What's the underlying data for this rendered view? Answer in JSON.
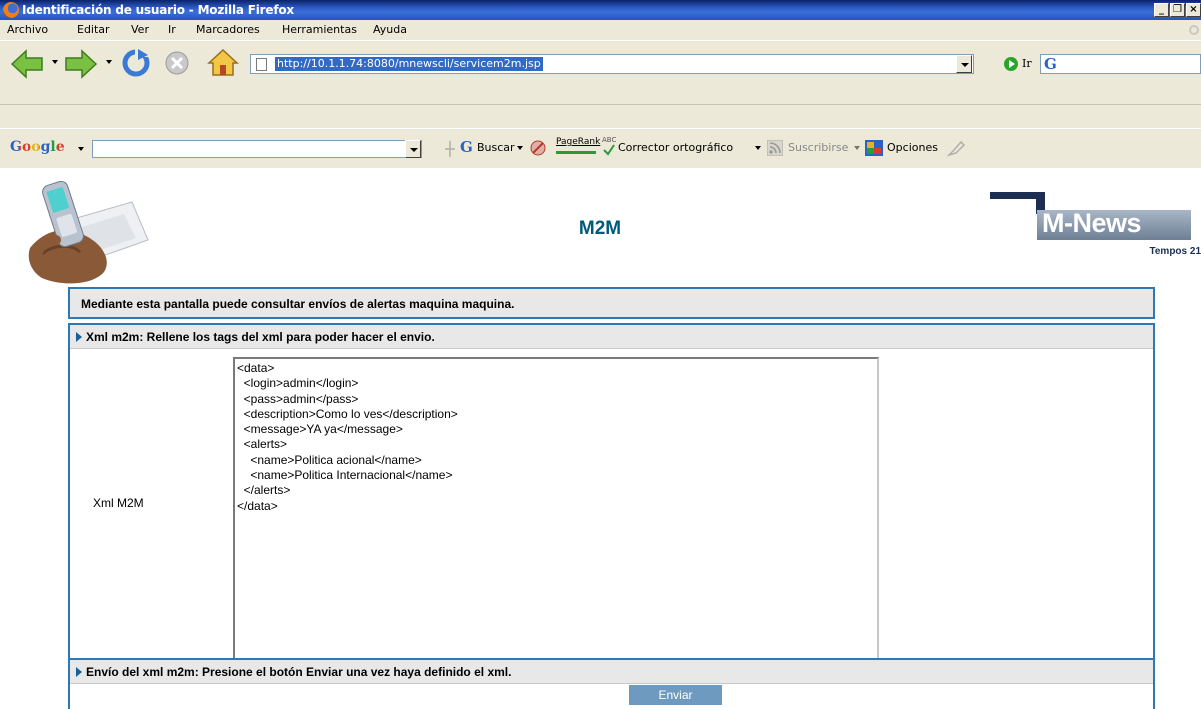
{
  "window": {
    "title": "Identificación de usuario - Mozilla Firefox",
    "controls": {
      "minimize": "_",
      "restore": "❐",
      "close": "×"
    }
  },
  "menu": [
    "Archivo",
    "Editar",
    "Ver",
    "Ir",
    "Marcadores",
    "Herramientas",
    "Ayuda"
  ],
  "navigation": {
    "url": "http://10.1.1.74:8080/mnewscli/servicem2m.jsp",
    "go_label": "Ir",
    "search_glyph": "G"
  },
  "google_toolbar": {
    "logo": "Google",
    "buscar": "Buscar",
    "pagerank": "PageRank",
    "abc": "ABC",
    "corrector": "Corrector ortográfico",
    "suscribirse": "Suscribirse",
    "opciones": "Opciones"
  },
  "page": {
    "heading": "M2M",
    "brand_logo": "M-News",
    "brand_sub": "Tempos 21",
    "intro": "Mediante esta pantalla puede consultar envíos de alertas maquina maquina.",
    "xml_section_title": "Xml m2m: Rellene los tags del xml para poder hacer el envio.",
    "xml_label": "Xml M2M",
    "xml_content": "<data>\n  <login>admin</login>\n  <pass>admin</pass>\n  <description>Como lo ves</description>\n  <message>YA ya</message>\n  <alerts>\n    <name>Politica acional</name>\n    <name>Politica Internacional</name>\n  </alerts>\n</data>",
    "send_section_title": "Envío del xml m2m: Presione el botón Enviar una vez haya definido el xml.",
    "send_button": "Enviar"
  }
}
